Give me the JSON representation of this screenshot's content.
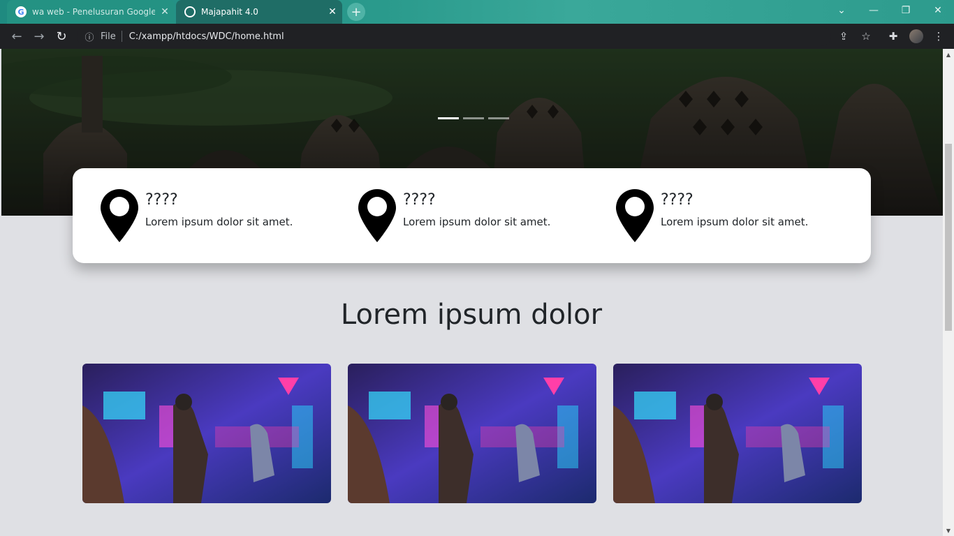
{
  "browser": {
    "tabs": [
      {
        "title": "wa web - Penelusuran Google",
        "favicon": "G",
        "active": false
      },
      {
        "title": "Majapahit 4.0",
        "favicon": "globe",
        "active": true
      }
    ],
    "new_tab_icon": "plus-icon",
    "window_controls": [
      "chevron-down-icon",
      "minimize-icon",
      "restore-icon",
      "close-icon"
    ],
    "omnibox": {
      "security_label": "File",
      "url": "C:/xampp/htdocs/WDC/home.html"
    },
    "toolbar_icons": [
      "share-icon",
      "star-icon",
      "extensions-icon",
      "profile-avatar",
      "menu-icon"
    ]
  },
  "hero": {
    "indicators": [
      true,
      false,
      false
    ]
  },
  "info_card": {
    "items": [
      {
        "title": "????",
        "text": "Lorem ipsum dolor sit amet.",
        "icon": "location-pin-icon"
      },
      {
        "title": "????",
        "text": "Lorem ipsum dolor sit amet.",
        "icon": "location-pin-icon"
      },
      {
        "title": "????",
        "text": "Lorem ipsum dolor sit amet.",
        "icon": "location-pin-icon"
      }
    ]
  },
  "section": {
    "title": "Lorem ipsum dolor",
    "gallery_count": 3
  },
  "colors": {
    "tab_strip": "#2a9a8c",
    "toolbar": "#202124",
    "page_bg": "#dfe0e4",
    "card_bg": "#ffffff"
  }
}
